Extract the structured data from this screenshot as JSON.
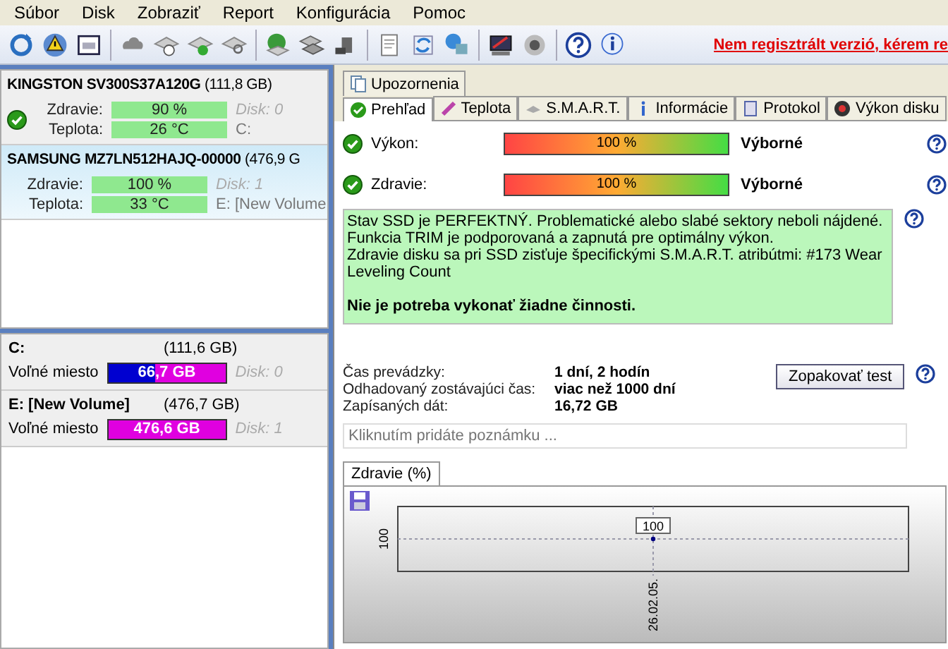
{
  "menu": [
    {
      "label": "Súbor"
    },
    {
      "label": "Disk"
    },
    {
      "label": "Zobraziť"
    },
    {
      "label": "Report"
    },
    {
      "label": "Konfigurácia"
    },
    {
      "label": "Pomoc"
    }
  ],
  "register_link": "Nem regisztrált verzió, kérem re",
  "disks": [
    {
      "model": "KINGSTON SV300S37A120G",
      "size": "(111,8 GB)",
      "health_label": "Zdravie:",
      "health": "90 %",
      "temp_label": "Teplota:",
      "temp": "26 °C",
      "disk": "Disk: 0",
      "volume": "C:",
      "selected": false
    },
    {
      "model": "SAMSUNG MZ7LN512HAJQ-00000",
      "size": "(476,9 G",
      "health_label": "Zdravie:",
      "health": "100 %",
      "temp_label": "Teplota:",
      "temp": "33 °C",
      "disk": "Disk: 1",
      "volume": "E: [New Volume",
      "selected": true
    }
  ],
  "volumes": [
    {
      "name": "C:",
      "size": "(111,6 GB)",
      "free_label": "Voľné miesto",
      "free": "66,7 GB",
      "level": 0.4,
      "disk": "Disk: 0"
    },
    {
      "name": "E: [New Volume]",
      "size": "(476,7 GB)",
      "free_label": "Voľné miesto",
      "free": "476,6 GB",
      "level": 0.0,
      "disk": "Disk: 1"
    }
  ],
  "top_tabs": [
    {
      "label": "Upozornenia",
      "selected": false
    }
  ],
  "tabs": [
    {
      "label": "Prehľad",
      "selected": true
    },
    {
      "label": "Teplota",
      "selected": false
    },
    {
      "label": "S.M.A.R.T.",
      "selected": false
    },
    {
      "label": "Informácie",
      "selected": false
    },
    {
      "label": "Protokol",
      "selected": false
    },
    {
      "label": "Výkon disku",
      "selected": false
    }
  ],
  "meters": [
    {
      "label": "Výkon:",
      "reading": "100 %",
      "level": 1.0,
      "verdict": "Výborné"
    },
    {
      "label": "Zdravie:",
      "reading": "100 %",
      "level": 1.0,
      "verdict": "Výborné"
    }
  ],
  "status_lines": [
    "Stav SSD je PERFEKTNÝ. Problematické alebo slabé sektory neboli nájdené.",
    "Funkcia TRIM je podporovaná a zapnutá pre optimálny výkon.",
    "Zdravie disku sa pri SSD zisťuje špecifickými S.M.A.R.T. atribútmi:  #173 Wear Leveling Count"
  ],
  "status_action": "Nie je potreba vykonať žiadne činnosti.",
  "stats": [
    {
      "label": "Čas prevádzky:",
      "value": "1 dní, 2 hodín"
    },
    {
      "label": "Odhadovaný zostávajúci čas:",
      "value": "viac než 1000 dní"
    },
    {
      "label": "Zapísaných dát:",
      "value": "16,72 GB"
    }
  ],
  "retest_button": "Zopakovať test",
  "note": {
    "placeholder": "Kliknutím pridáte poznámku ..."
  },
  "chart_tab": {
    "label": "Zdravie (%)",
    "selected": true
  },
  "chart": {
    "y_tick": "100",
    "point_label": "100",
    "x_tick": "26.02.05."
  }
}
